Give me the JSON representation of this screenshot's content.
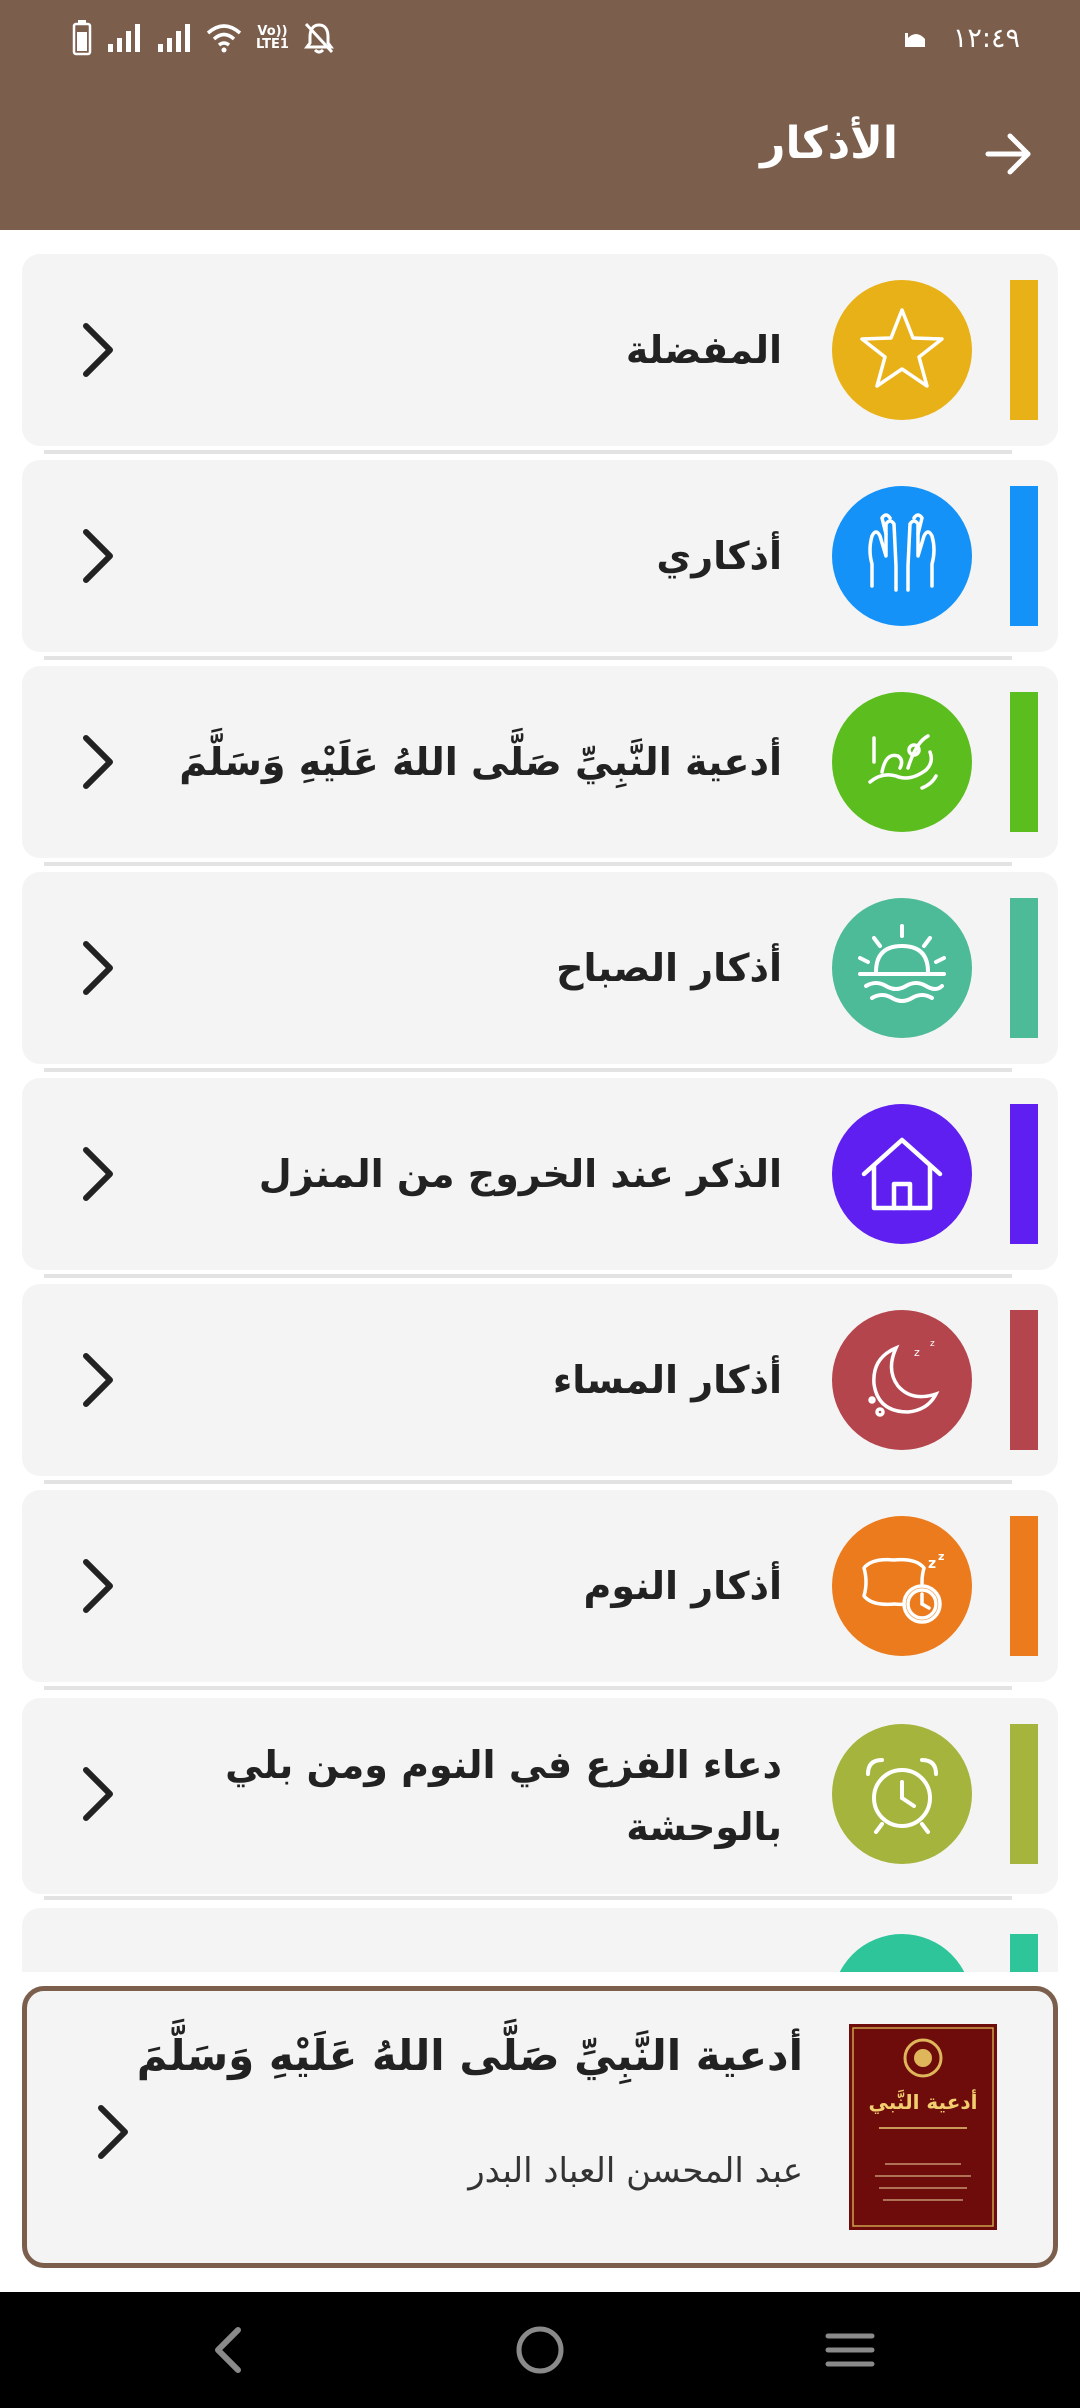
{
  "status_bar": {
    "time": "١٢:٤٩",
    "network_badge_top": "Vo))",
    "network_badge_bottom": "LTE1"
  },
  "app_bar": {
    "title": "الأذكار",
    "back_icon": "arrow-right-icon"
  },
  "list": {
    "items": [
      {
        "label": "المفضلة",
        "color": "#e9b118",
        "icon": "star-icon"
      },
      {
        "label": "أذكاري",
        "color": "#1592f7",
        "icon": "praying-hands-icon"
      },
      {
        "label": "أدعية النَّبِيِّ صَلَّى اللهُ عَلَيْهِ وَسَلَّمَ",
        "color": "#5cbd1e",
        "icon": "muhammad-calligraphy-icon"
      },
      {
        "label": "أذكار الصباح",
        "color": "#4dbb98",
        "icon": "sunrise-icon"
      },
      {
        "label": "الذكر عند الخروج من المنزل",
        "color": "#5e1ff0",
        "icon": "house-icon"
      },
      {
        "label": "أذكار المساء",
        "color": "#b5454d",
        "icon": "moon-icon"
      },
      {
        "label": "أذكار النوم",
        "color": "#eb7b1c",
        "icon": "pillow-clock-icon"
      },
      {
        "label": "دعاء الفزع في النوم ومن بلي بالوحشة",
        "color": "#a5b43c",
        "icon": "alarm-clock-icon"
      },
      {
        "label": "",
        "color": "#2fc59a",
        "icon": "partial-icon"
      }
    ]
  },
  "featured": {
    "title": "أدعية النَّبِيِّ صَلَّى اللهُ عَلَيْهِ وَسَلَّمَ",
    "author": "عبد المحسن العباد البدر",
    "cover_title": "أدعية النَّبي",
    "cover_color": "#6e0c0c"
  },
  "nav_bar": {
    "back": "back-icon",
    "home": "home-icon",
    "menu": "menu-icon"
  }
}
